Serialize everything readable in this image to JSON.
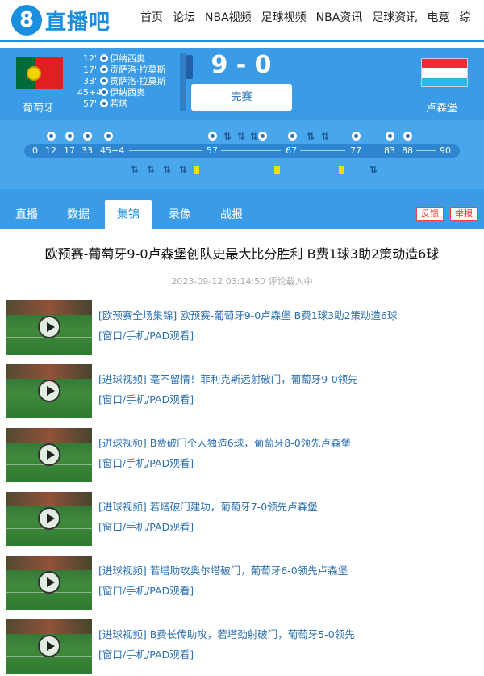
{
  "site": {
    "logo_num": "8",
    "logo_text": "直播吧"
  },
  "nav": [
    "首页",
    "论坛",
    "NBA视频",
    "足球视频",
    "NBA资讯",
    "足球资讯",
    "电竞",
    "综"
  ],
  "match": {
    "home": "葡萄牙",
    "away": "卢森堡",
    "score": "9 - 0",
    "status": "完赛",
    "events": [
      {
        "min": "12'",
        "player": "伊纳西奥"
      },
      {
        "min": "17'",
        "player": "贡萨洛·拉莫斯"
      },
      {
        "min": "33'",
        "player": "贡萨洛·拉莫斯"
      },
      {
        "min": "45+4'",
        "player": "伊纳西奥"
      },
      {
        "min": "57'",
        "player": "若塔"
      }
    ]
  },
  "timeline": {
    "labels": [
      "0",
      "12",
      "17",
      "33",
      "45+4",
      "57",
      "67",
      "77",
      "83",
      "88",
      "90"
    ]
  },
  "tabs": [
    "直播",
    "数据",
    "集锦",
    "录像",
    "战报"
  ],
  "actions": {
    "feedback": "反馈",
    "report": "举报"
  },
  "article": {
    "title": "欧预赛-葡萄牙9-0卢森堡创队史最大比分胜利 B费1球3助2策动造6球",
    "meta": "2023-09-12 03:14:50 评论载入中"
  },
  "videos": [
    {
      "title": "[欧预赛全场集锦] 欧预赛-葡萄牙9-0卢森堡 B费1球3助2策动造6球",
      "link": "[窗口/手机/PAD观看]"
    },
    {
      "title": "[进球视频] 毫不留情！菲利克斯远射破门，葡萄牙9-0领先",
      "link": "[窗口/手机/PAD观看]"
    },
    {
      "title": "[进球视频] B费破门个人独造6球，葡萄牙8-0领先卢森堡",
      "link": "[窗口/手机/PAD观看]"
    },
    {
      "title": "[进球视频] 若塔破门建功，葡萄牙7-0领先卢森堡",
      "link": "[窗口/手机/PAD观看]"
    },
    {
      "title": "[进球视频] 若塔助攻奥尔塔破门，葡萄牙6-0领先卢森堡",
      "link": "[窗口/手机/PAD观看]"
    },
    {
      "title": "[进球视频] B费长传助攻，若塔劲射破门，葡萄牙5-0领先",
      "link": "[窗口/手机/PAD观看]"
    }
  ],
  "colors": {
    "brand": "#1a8fe0",
    "header_bg": "#3a9be6",
    "link": "#2a6fb0",
    "alert": "#e33333"
  }
}
